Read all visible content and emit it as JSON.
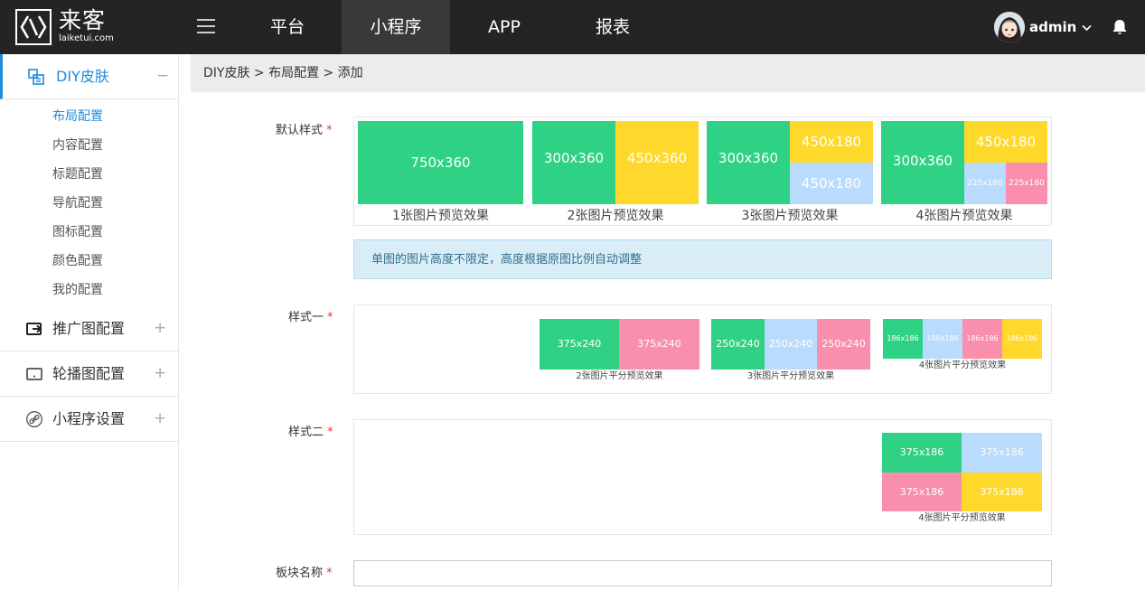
{
  "header": {
    "logo_cn": "来客",
    "logo_en": "laiketui.com",
    "nav": [
      {
        "label": "平台"
      },
      {
        "label": "小程序"
      },
      {
        "label": "APP"
      },
      {
        "label": "报表"
      }
    ],
    "active_nav": "小程序",
    "user": "admin"
  },
  "sidebar": {
    "groups": [
      {
        "label": "DIY皮肤",
        "state": "−",
        "expanded": true
      },
      {
        "label": "推广图配置",
        "state": "+"
      },
      {
        "label": "轮播图配置",
        "state": "+"
      },
      {
        "label": "小程序设置",
        "state": "+"
      }
    ],
    "sub_items": [
      "布局配置",
      "内容配置",
      "标题配置",
      "导航配置",
      "图标配置",
      "颜色配置",
      "我的配置"
    ],
    "selected_sub": "布局配置"
  },
  "breadcrumb": "DIY皮肤 > 布局配置 > 添加",
  "form": {
    "default_style": {
      "label": "默认样式",
      "options": [
        {
          "caption": "1张图片预览效果",
          "tiles": [
            "750x360"
          ]
        },
        {
          "caption": "2张图片预览效果",
          "tiles": [
            "300x360",
            "450x360"
          ]
        },
        {
          "caption": "3张图片预览效果",
          "tiles": [
            "300x360",
            "450x180",
            "450x180"
          ]
        },
        {
          "caption": "4张图片预览效果",
          "tiles": [
            "300x360",
            "450x180",
            "225x180",
            "225x180"
          ]
        }
      ]
    },
    "notice": "单图的图片高度不限定，高度根据原图比例自动调整",
    "style_one": {
      "label": "样式一",
      "options": [
        {
          "caption": "2张图片平分预览效果",
          "tiles": [
            "375x240",
            "375x240"
          ]
        },
        {
          "caption": "3张图片平分预览效果",
          "tiles": [
            "250x240",
            "250x240",
            "250x240"
          ]
        },
        {
          "caption": "4张图片平分预览效果",
          "tiles": [
            "186x186",
            "186x186",
            "186x186",
            "186x186"
          ]
        }
      ]
    },
    "style_two": {
      "label": "样式二",
      "options": [
        {
          "caption": "4张图片平分预览效果",
          "tiles": [
            "375x186",
            "375x186",
            "375x186",
            "375x186"
          ]
        }
      ]
    },
    "block_name": {
      "label": "板块名称",
      "value": ""
    },
    "required_mark": "*"
  },
  "colors": {
    "green": "#2fd184",
    "yellow": "#fed92b",
    "blue": "#b9dbfd",
    "pink": "#f98ead",
    "accent": "#1e8cde",
    "header_bg": "#242424"
  }
}
